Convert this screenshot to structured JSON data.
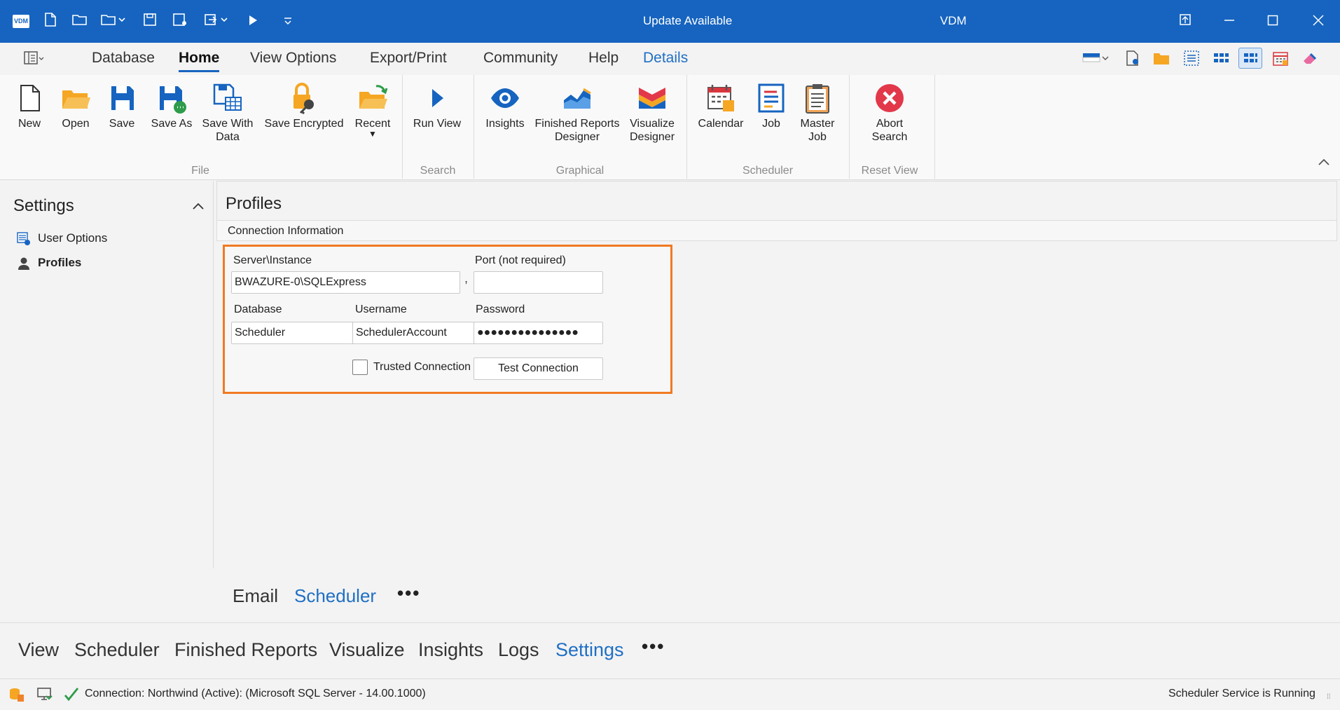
{
  "titlebar": {
    "logo": "VDM",
    "center_text": "Update Available",
    "app_title": "VDM",
    "quick_tools": [
      "new-document-icon",
      "open-folder-icon",
      "open-recent-icon",
      "save-icon",
      "save-as-icon",
      "export-icon",
      "run-icon",
      "customize-icon"
    ]
  },
  "menu": {
    "tabs": [
      "Database",
      "Home",
      "View Options",
      "Export/Print",
      "Community",
      "Help",
      "Details"
    ],
    "active": "Home"
  },
  "ribbon": {
    "file": {
      "label": "File",
      "buttons": [
        {
          "label": "New"
        },
        {
          "label": "Open"
        },
        {
          "label": "Save"
        },
        {
          "label": "Save As"
        },
        {
          "label_1": "Save With",
          "label_2": "Data"
        },
        {
          "label": "Save Encrypted"
        },
        {
          "label": "Recent"
        }
      ]
    },
    "search": {
      "label": "Search",
      "run_view": "Run View"
    },
    "graphical": {
      "label": "Graphical",
      "insights": "Insights",
      "finished_1": "Finished Reports",
      "finished_2": "Designer",
      "visualize_1": "Visualize",
      "visualize_2": "Designer"
    },
    "scheduler": {
      "label": "Scheduler",
      "calendar": "Calendar",
      "job": "Job",
      "master_1": "Master",
      "master_2": "Job"
    },
    "reset_view": {
      "label": "Reset View",
      "abort_1": "Abort",
      "abort_2": "Search"
    }
  },
  "settings_panel": {
    "title": "Settings",
    "items": [
      "User Options",
      "Profiles"
    ],
    "active": "Profiles"
  },
  "profiles": {
    "title": "Profiles",
    "section": "Connection Information",
    "server_label": "Server\\Instance",
    "server_value": "BWAZURE-0\\SQLExpress",
    "comma": ",",
    "port_label": "Port (not required)",
    "port_value": "",
    "database_label": "Database",
    "database_value": "Scheduler",
    "username_label": "Username",
    "username_value": "SchedulerAccount",
    "password_label": "Password",
    "password_value": "●●●●●●●●●●●●●●●",
    "trusted_label": "Trusted Connection",
    "test_button": "Test Connection",
    "inner_tabs": [
      "Email",
      "Scheduler"
    ],
    "inner_active": "Scheduler",
    "more": "•••"
  },
  "navtabs": {
    "items": [
      "View",
      "Scheduler",
      "Finished Reports",
      "Visualize",
      "Insights",
      "Logs",
      "Settings"
    ],
    "active": "Settings",
    "more": "•••"
  },
  "statusbar": {
    "connection": "Connection: Northwind (Active): (Microsoft SQL Server - 14.00.1000)",
    "service": "Scheduler Service is Running"
  },
  "colors": {
    "titlebar": "#1664c0",
    "accent": "#1f6fc5",
    "highlight_border": "#f07a22"
  }
}
